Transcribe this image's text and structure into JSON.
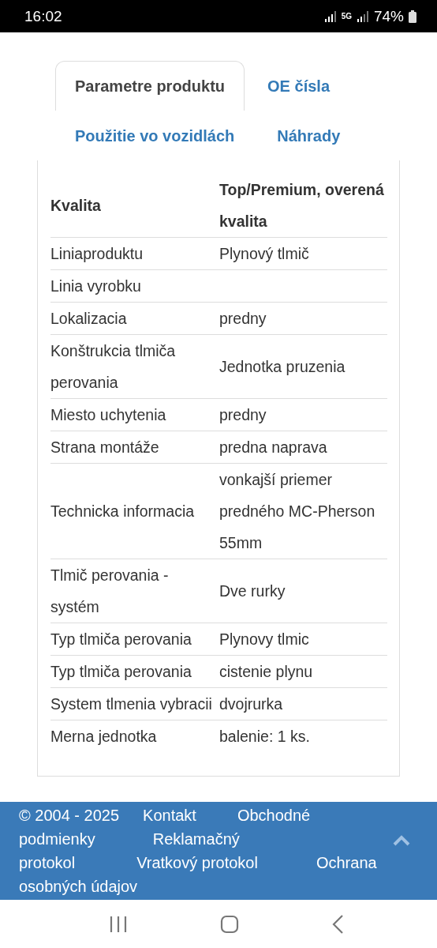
{
  "status_bar": {
    "time": "16:02",
    "network": "5G",
    "battery": "74%"
  },
  "tabs": [
    {
      "label": "Parametre produktu",
      "selected": true
    },
    {
      "label": "OE čísla",
      "selected": false
    },
    {
      "label": "Použitie vo vozidlách",
      "selected": false
    },
    {
      "label": "Náhrady",
      "selected": false
    }
  ],
  "table": {
    "rows": [
      {
        "kind": "header",
        "name": "Kvalita",
        "value": "Top/Premium, overená kvalita"
      },
      {
        "kind": "row",
        "name": "Liniaproduktu",
        "value": "Plynový tlmič"
      },
      {
        "kind": "row",
        "name": "Linia vyrobku"
      },
      {
        "kind": "row",
        "name": "Lokalizacia",
        "value": "predny"
      },
      {
        "kind": "row",
        "name": "Konštrukcia tlmiča perovania",
        "value": "Jednotka pruzenia"
      },
      {
        "kind": "row",
        "name": "Miesto uchytenia",
        "value": "predny"
      },
      {
        "kind": "row",
        "name": "Strana montáže",
        "value": "predna naprava"
      },
      {
        "kind": "row",
        "name": "Technicka informacia",
        "value": "vonkajší priemer predného MC-Pherson 55mm"
      },
      {
        "kind": "row",
        "name": "Tlmič perovania - systém",
        "value": "Dve rurky"
      },
      {
        "kind": "row",
        "name": "Typ tlmiča perovania",
        "value": "Plynovy tlmic"
      },
      {
        "kind": "row",
        "name": "Typ tlmiča perovania",
        "value": "cistenie plynu"
      },
      {
        "kind": "row",
        "name": "System tlmenia vybracii",
        "value": "dvojrurka"
      },
      {
        "kind": "row",
        "name": "Merna jednotka",
        "value": "balenie: 1 ks."
      }
    ]
  },
  "footer": {
    "copyright": "© 2004 - 2025",
    "links": [
      "Kontakt",
      "Obchodné podmienky",
      "Reklamačný protokol",
      "Vratkový protokol",
      "Ochrana osobných údajov"
    ]
  }
}
